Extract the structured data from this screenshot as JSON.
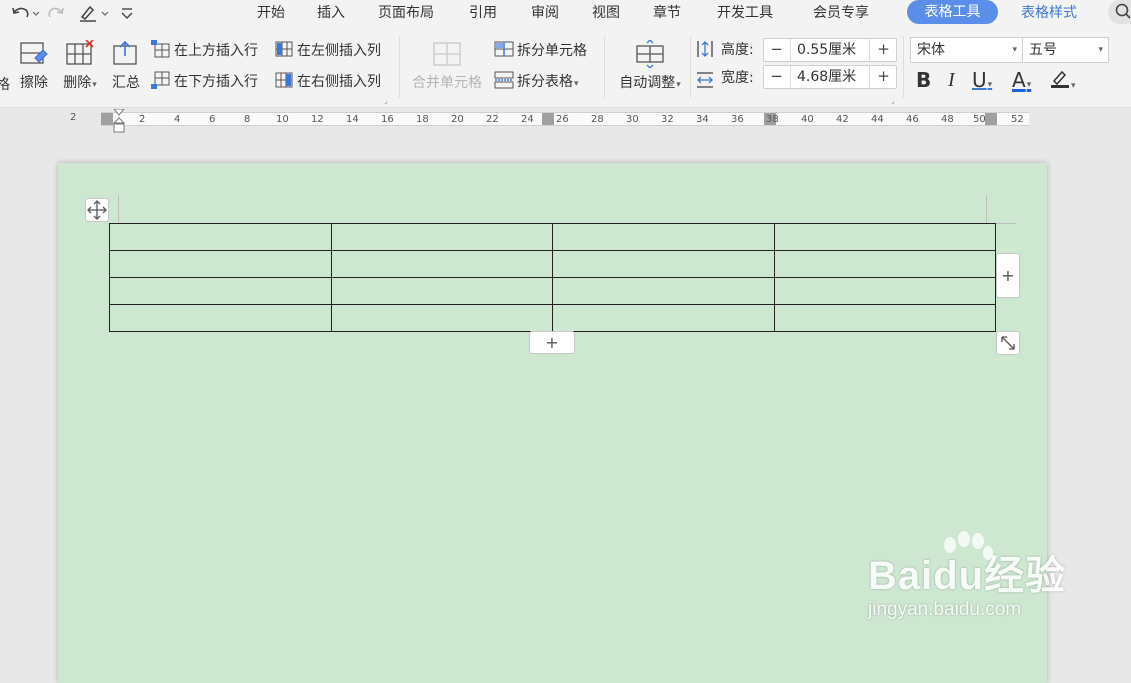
{
  "tabs": {
    "items": [
      "开始",
      "插入",
      "页面布局",
      "引用",
      "审阅",
      "视图",
      "章节",
      "开发工具",
      "会员专享"
    ],
    "active": "表格工具",
    "style": "表格样式"
  },
  "ribbon": {
    "partial_left": "格",
    "erase": "擦除",
    "delete": "删除",
    "summary": "汇总",
    "insert_above": "在上方插入行",
    "insert_below": "在下方插入行",
    "insert_left": "在左侧插入列",
    "insert_right": "在右侧插入列",
    "merge_cells": "合并单元格",
    "split_cells": "拆分单元格",
    "split_table": "拆分表格",
    "auto_fit": "自动调整",
    "height_label": "高度:",
    "height_value": "0.55厘米",
    "width_label": "宽度:",
    "width_value": "4.68厘米",
    "font_name": "宋体",
    "font_size": "五号",
    "bold": "B",
    "italic": "I",
    "underline": "U",
    "font_color": "A"
  },
  "ruler": {
    "ticks": [
      "2",
      "2",
      "4",
      "6",
      "8",
      "10",
      "12",
      "14",
      "16",
      "18",
      "20",
      "22",
      "24",
      "26",
      "28",
      "30",
      "32",
      "34",
      "36",
      "38",
      "40",
      "42",
      "44",
      "46",
      "48",
      "50",
      "52"
    ]
  },
  "table": {
    "rows": 4,
    "cols": 4
  },
  "colors": {
    "page_background": "#cde7d0",
    "active_tab": "#5b8ee8",
    "accent_blue": "#3c78d8"
  },
  "watermark": {
    "brand": "Baidu经验",
    "url": "jingyan.baidu.com"
  }
}
